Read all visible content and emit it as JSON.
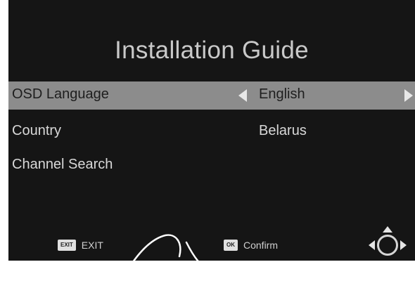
{
  "screen": {
    "title": "Installation Guide",
    "menu": [
      {
        "label": "OSD Language",
        "value": "English",
        "selected": true
      },
      {
        "label": "Country",
        "value": "Belarus",
        "selected": false
      },
      {
        "label": "Channel Search",
        "value": "",
        "selected": false
      }
    ]
  },
  "footer": {
    "exit_badge": "EXIT",
    "exit_label": "EXIT",
    "ok_badge": "OK",
    "ok_label": "Confirm"
  },
  "colors": {
    "background": "#151515",
    "highlight": "#8c8c8c",
    "text": "#d8d8d8"
  }
}
